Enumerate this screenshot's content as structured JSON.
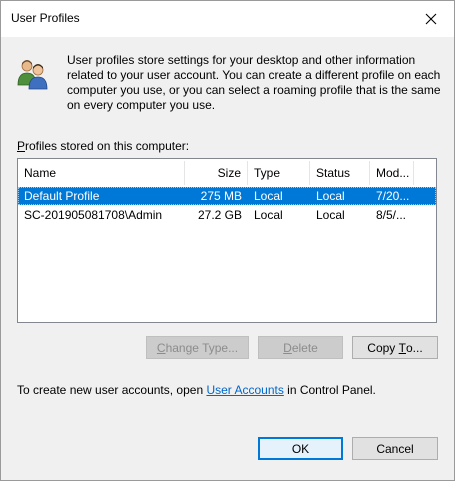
{
  "window": {
    "title": "User Profiles"
  },
  "intro_text": "User profiles store settings for your desktop and other information related to your user account. You can create a different profile on each computer you use, or you can select a roaming profile that is the same on every computer you use.",
  "profiles_label": {
    "accel": "P",
    "rest": "rofiles stored on this computer:"
  },
  "table": {
    "columns": [
      "Name",
      "Size",
      "Type",
      "Status",
      "Mod..."
    ],
    "rows": [
      {
        "name": "Default Profile",
        "size": "275 MB",
        "type": "Local",
        "status": "Local",
        "modified": "7/20...",
        "selected": true
      },
      {
        "name": "SC-201905081708\\Admin",
        "size": "27.2 GB",
        "type": "Local",
        "status": "Local",
        "modified": "8/5/...",
        "selected": false
      }
    ]
  },
  "buttons": {
    "change_type": {
      "pre": "",
      "accel": "C",
      "post": "hange Type..."
    },
    "delete": {
      "pre": "",
      "accel": "D",
      "post": "elete"
    },
    "copy_to": {
      "pre": "Copy ",
      "accel": "T",
      "post": "o..."
    },
    "ok": "OK",
    "cancel": "Cancel"
  },
  "footer": {
    "pre": "To create new user accounts, open ",
    "link": "User Accounts",
    "post": " in Control Panel."
  },
  "icons": {
    "close": "close-icon",
    "users": "users-icon"
  }
}
